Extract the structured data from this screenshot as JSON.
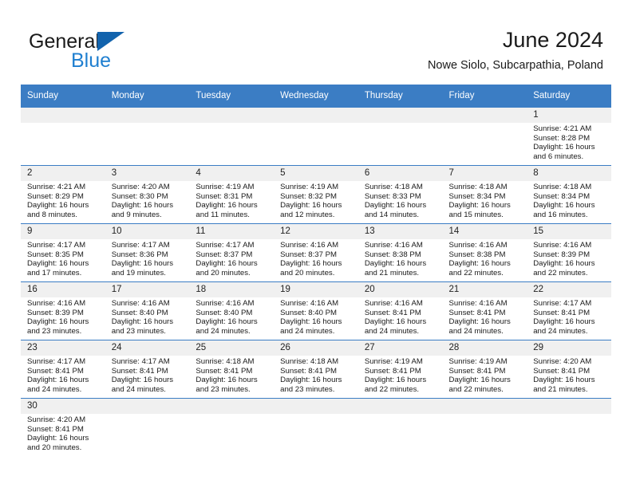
{
  "brand": {
    "name_top": "General",
    "name_bottom": "Blue",
    "triangle_color": "#1263ad",
    "blue_color": "#1f7fd0"
  },
  "header": {
    "title": "June 2024",
    "subtitle": "Nowe Siolo, Subcarpathia, Poland"
  },
  "theme": {
    "header_blue": "#3b7dc4",
    "daynum_bg": "#f0f0f0",
    "text": "#1a1a1a"
  },
  "labels": {
    "sunrise_prefix": "Sunrise:",
    "sunset_prefix": "Sunset:",
    "daylight_prefix": "Daylight:"
  },
  "weekdays": [
    "Sunday",
    "Monday",
    "Tuesday",
    "Wednesday",
    "Thursday",
    "Friday",
    "Saturday"
  ],
  "weeks": [
    [
      {
        "day": "",
        "blank": true
      },
      {
        "day": "",
        "blank": true
      },
      {
        "day": "",
        "blank": true
      },
      {
        "day": "",
        "blank": true
      },
      {
        "day": "",
        "blank": true
      },
      {
        "day": "",
        "blank": true
      },
      {
        "day": "1",
        "sunrise": "Sunrise: 4:21 AM",
        "sunset": "Sunset: 8:28 PM",
        "daylight1": "Daylight: 16 hours",
        "daylight2": "and 6 minutes."
      }
    ],
    [
      {
        "day": "2",
        "sunrise": "Sunrise: 4:21 AM",
        "sunset": "Sunset: 8:29 PM",
        "daylight1": "Daylight: 16 hours",
        "daylight2": "and 8 minutes."
      },
      {
        "day": "3",
        "sunrise": "Sunrise: 4:20 AM",
        "sunset": "Sunset: 8:30 PM",
        "daylight1": "Daylight: 16 hours",
        "daylight2": "and 9 minutes."
      },
      {
        "day": "4",
        "sunrise": "Sunrise: 4:19 AM",
        "sunset": "Sunset: 8:31 PM",
        "daylight1": "Daylight: 16 hours",
        "daylight2": "and 11 minutes."
      },
      {
        "day": "5",
        "sunrise": "Sunrise: 4:19 AM",
        "sunset": "Sunset: 8:32 PM",
        "daylight1": "Daylight: 16 hours",
        "daylight2": "and 12 minutes."
      },
      {
        "day": "6",
        "sunrise": "Sunrise: 4:18 AM",
        "sunset": "Sunset: 8:33 PM",
        "daylight1": "Daylight: 16 hours",
        "daylight2": "and 14 minutes."
      },
      {
        "day": "7",
        "sunrise": "Sunrise: 4:18 AM",
        "sunset": "Sunset: 8:34 PM",
        "daylight1": "Daylight: 16 hours",
        "daylight2": "and 15 minutes."
      },
      {
        "day": "8",
        "sunrise": "Sunrise: 4:18 AM",
        "sunset": "Sunset: 8:34 PM",
        "daylight1": "Daylight: 16 hours",
        "daylight2": "and 16 minutes."
      }
    ],
    [
      {
        "day": "9",
        "sunrise": "Sunrise: 4:17 AM",
        "sunset": "Sunset: 8:35 PM",
        "daylight1": "Daylight: 16 hours",
        "daylight2": "and 17 minutes."
      },
      {
        "day": "10",
        "sunrise": "Sunrise: 4:17 AM",
        "sunset": "Sunset: 8:36 PM",
        "daylight1": "Daylight: 16 hours",
        "daylight2": "and 19 minutes."
      },
      {
        "day": "11",
        "sunrise": "Sunrise: 4:17 AM",
        "sunset": "Sunset: 8:37 PM",
        "daylight1": "Daylight: 16 hours",
        "daylight2": "and 20 minutes."
      },
      {
        "day": "12",
        "sunrise": "Sunrise: 4:16 AM",
        "sunset": "Sunset: 8:37 PM",
        "daylight1": "Daylight: 16 hours",
        "daylight2": "and 20 minutes."
      },
      {
        "day": "13",
        "sunrise": "Sunrise: 4:16 AM",
        "sunset": "Sunset: 8:38 PM",
        "daylight1": "Daylight: 16 hours",
        "daylight2": "and 21 minutes."
      },
      {
        "day": "14",
        "sunrise": "Sunrise: 4:16 AM",
        "sunset": "Sunset: 8:38 PM",
        "daylight1": "Daylight: 16 hours",
        "daylight2": "and 22 minutes."
      },
      {
        "day": "15",
        "sunrise": "Sunrise: 4:16 AM",
        "sunset": "Sunset: 8:39 PM",
        "daylight1": "Daylight: 16 hours",
        "daylight2": "and 22 minutes."
      }
    ],
    [
      {
        "day": "16",
        "sunrise": "Sunrise: 4:16 AM",
        "sunset": "Sunset: 8:39 PM",
        "daylight1": "Daylight: 16 hours",
        "daylight2": "and 23 minutes."
      },
      {
        "day": "17",
        "sunrise": "Sunrise: 4:16 AM",
        "sunset": "Sunset: 8:40 PM",
        "daylight1": "Daylight: 16 hours",
        "daylight2": "and 23 minutes."
      },
      {
        "day": "18",
        "sunrise": "Sunrise: 4:16 AM",
        "sunset": "Sunset: 8:40 PM",
        "daylight1": "Daylight: 16 hours",
        "daylight2": "and 24 minutes."
      },
      {
        "day": "19",
        "sunrise": "Sunrise: 4:16 AM",
        "sunset": "Sunset: 8:40 PM",
        "daylight1": "Daylight: 16 hours",
        "daylight2": "and 24 minutes."
      },
      {
        "day": "20",
        "sunrise": "Sunrise: 4:16 AM",
        "sunset": "Sunset: 8:41 PM",
        "daylight1": "Daylight: 16 hours",
        "daylight2": "and 24 minutes."
      },
      {
        "day": "21",
        "sunrise": "Sunrise: 4:16 AM",
        "sunset": "Sunset: 8:41 PM",
        "daylight1": "Daylight: 16 hours",
        "daylight2": "and 24 minutes."
      },
      {
        "day": "22",
        "sunrise": "Sunrise: 4:17 AM",
        "sunset": "Sunset: 8:41 PM",
        "daylight1": "Daylight: 16 hours",
        "daylight2": "and 24 minutes."
      }
    ],
    [
      {
        "day": "23",
        "sunrise": "Sunrise: 4:17 AM",
        "sunset": "Sunset: 8:41 PM",
        "daylight1": "Daylight: 16 hours",
        "daylight2": "and 24 minutes."
      },
      {
        "day": "24",
        "sunrise": "Sunrise: 4:17 AM",
        "sunset": "Sunset: 8:41 PM",
        "daylight1": "Daylight: 16 hours",
        "daylight2": "and 24 minutes."
      },
      {
        "day": "25",
        "sunrise": "Sunrise: 4:18 AM",
        "sunset": "Sunset: 8:41 PM",
        "daylight1": "Daylight: 16 hours",
        "daylight2": "and 23 minutes."
      },
      {
        "day": "26",
        "sunrise": "Sunrise: 4:18 AM",
        "sunset": "Sunset: 8:41 PM",
        "daylight1": "Daylight: 16 hours",
        "daylight2": "and 23 minutes."
      },
      {
        "day": "27",
        "sunrise": "Sunrise: 4:19 AM",
        "sunset": "Sunset: 8:41 PM",
        "daylight1": "Daylight: 16 hours",
        "daylight2": "and 22 minutes."
      },
      {
        "day": "28",
        "sunrise": "Sunrise: 4:19 AM",
        "sunset": "Sunset: 8:41 PM",
        "daylight1": "Daylight: 16 hours",
        "daylight2": "and 22 minutes."
      },
      {
        "day": "29",
        "sunrise": "Sunrise: 4:20 AM",
        "sunset": "Sunset: 8:41 PM",
        "daylight1": "Daylight: 16 hours",
        "daylight2": "and 21 minutes."
      }
    ],
    [
      {
        "day": "30",
        "sunrise": "Sunrise: 4:20 AM",
        "sunset": "Sunset: 8:41 PM",
        "daylight1": "Daylight: 16 hours",
        "daylight2": "and 20 minutes."
      },
      {
        "day": "",
        "blank": true
      },
      {
        "day": "",
        "blank": true
      },
      {
        "day": "",
        "blank": true
      },
      {
        "day": "",
        "blank": true
      },
      {
        "day": "",
        "blank": true
      },
      {
        "day": "",
        "blank": true
      }
    ]
  ]
}
